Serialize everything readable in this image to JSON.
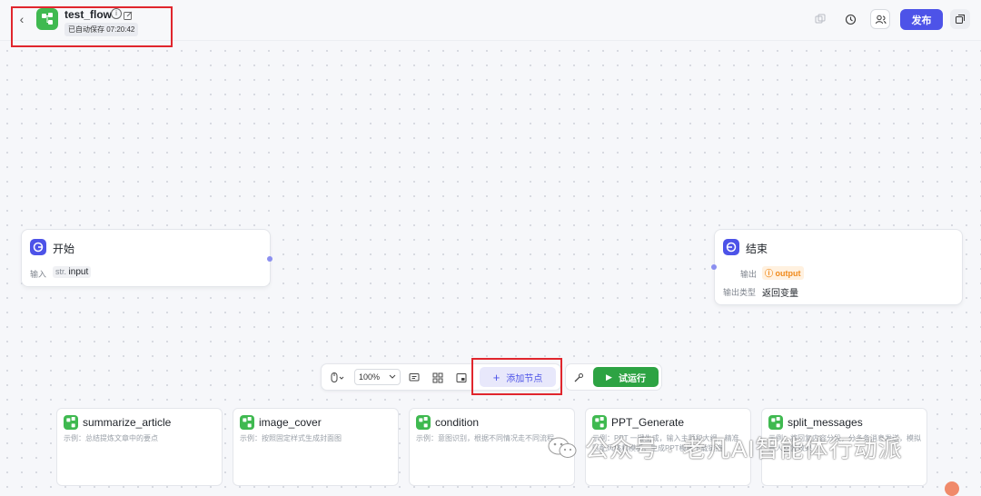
{
  "header": {
    "back_icon": "chevron-left-icon",
    "app_icon": "workflow-icon",
    "title": "test_flow",
    "autosave": "已自动保存 07:20:42",
    "publish_label": "发布"
  },
  "nodes": {
    "start": {
      "title": "开始",
      "input_label": "输入",
      "type_tag": "str.",
      "param": "input"
    },
    "end": {
      "title": "结束",
      "output_label": "输出",
      "output_tag": "output",
      "output_type_label": "输出类型",
      "output_type_value": "返回变量"
    }
  },
  "toolbar": {
    "zoom": "100%",
    "add_node_label": "添加节点",
    "run_label": "试运行"
  },
  "templates": [
    {
      "title": "summarize_article",
      "desc": "示例：总结提炼文章中的要点"
    },
    {
      "title": "image_cover",
      "desc": "示例：按照固定样式生成封面图"
    },
    {
      "title": "condition",
      "desc": "示例：意图识别，根据不同情况走不同流程"
    },
    {
      "title": "PPT_Generate",
      "desc": "示例：PPT 一键生成，输入主题和大纲，精准匹配风格和模板，生成PPT模板下载链接"
    },
    {
      "title": "split_messages",
      "desc": "示例：将回复内容分段，分多条消息发送，模拟真人回复效果"
    }
  ],
  "watermark": "公众号 · 老凡AI智能体行动派",
  "colors": {
    "primary": "#4d53e8",
    "run_green": "#2da343",
    "highlight_red": "#e0262d",
    "workflow_green": "#3fb950"
  }
}
